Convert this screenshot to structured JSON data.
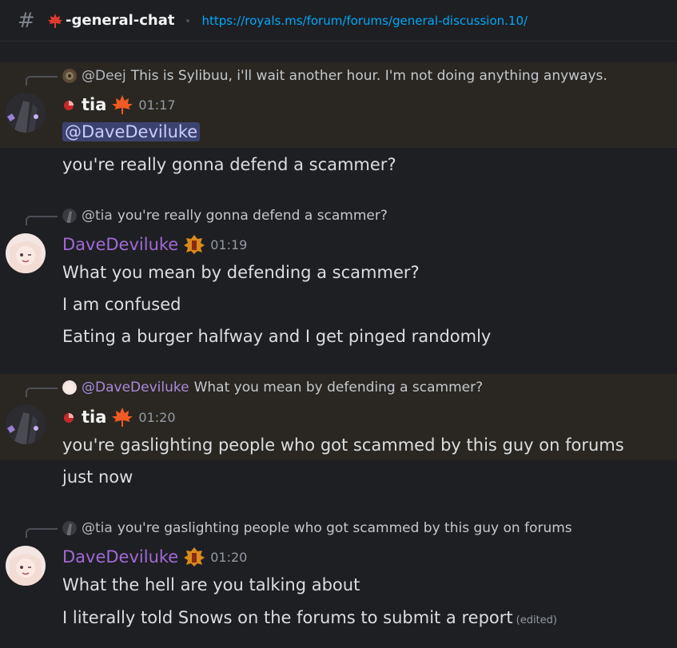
{
  "header": {
    "hash": "#",
    "channel_name": "-general-chat",
    "topic_link": "https://royals.ms/forum/forums/general-discussion.10/"
  },
  "messages": [
    {
      "reply": {
        "user": "@Deej",
        "text": "This is Sylibuu, i'll wait another hour. I'm not doing anything anyways."
      },
      "author": "tia",
      "time": "01:17",
      "mention": "@DaveDeviluke",
      "lines": [
        "you're really gonna defend a scammer?"
      ]
    },
    {
      "reply": {
        "user": "@tia",
        "text": "you're really gonna defend a scammer?"
      },
      "author": "DaveDeviluke",
      "time": "01:19",
      "lines": [
        "What you mean by defending a scammer?",
        "I am confused",
        "Eating a burger halfway and I get pinged randomly"
      ]
    },
    {
      "reply": {
        "user": "@DaveDeviluke",
        "text": "What you mean by defending a scammer?"
      },
      "author": "tia",
      "time": "01:20",
      "lines": [
        "you're gaslighting people who got scammed by this guy on forums",
        "just now"
      ]
    },
    {
      "reply": {
        "user": "@tia",
        "text": "you're gaslighting people who got scammed by this guy on forums"
      },
      "author": "DaveDeviluke",
      "time": "01:20",
      "lines": [
        "What the hell are you talking about",
        "I literally told Snows on the forums to submit a report"
      ],
      "edited": "(edited)"
    }
  ],
  "colors": {
    "background": "#1e1f22",
    "highlight_bg": "#2a2722",
    "link": "#00a8fc",
    "purple_name": "#a06ad6",
    "mention_bg": "#3c4270"
  }
}
